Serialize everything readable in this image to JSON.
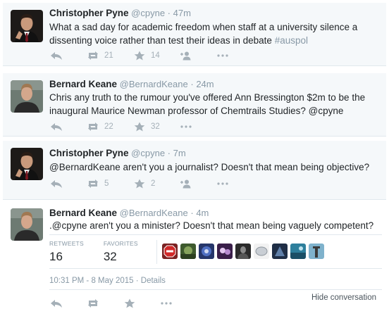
{
  "tweets": [
    {
      "name": "Christopher Pyne",
      "handle": "@cpyne",
      "sep": "·",
      "time": "47m",
      "text": "What a sad day for academic freedom when staff at a university silence a dissenting voice rather than test their ideas in debate ",
      "hashtag": "#auspol",
      "retweets": "21",
      "favorites": "14"
    },
    {
      "name": "Bernard Keane",
      "handle": "@BernardKeane",
      "sep": "·",
      "time": "24m",
      "text": "Chris any truth to the rumour you've offered Ann Bressington $2m to be the inaugural Maurice Newman professor of Chemtrails Studies? @cpyne",
      "retweets": "22",
      "favorites": "32"
    },
    {
      "name": "Christopher Pyne",
      "handle": "@cpyne",
      "sep": "·",
      "time": "7m",
      "text": "@BernardKeane aren't you a journalist? Doesn't that mean being objective?",
      "retweets": "5",
      "favorites": "2"
    },
    {
      "name": "Bernard Keane",
      "handle": "@BernardKeane",
      "sep": "·",
      "time": "4m",
      "text": ".@cpyne aren't you a minister? Doesn't that mean being vaguely competent?",
      "stats": {
        "retweets_label": "RETWEETS",
        "retweets_value": "16",
        "favorites_label": "FAVORITES",
        "favorites_value": "32"
      },
      "datetime": "10:31 PM - 8 May 2015",
      "sep2": " · ",
      "details": "Details",
      "hide_conversation": "Hide conversation"
    }
  ],
  "icons": {
    "reply": "reply-icon",
    "retweet": "retweet-icon",
    "favorite": "star-icon",
    "follow": "add-user-icon",
    "more": "more-dots-icon"
  },
  "colors": {
    "background": "#f5f8fa",
    "text": "#1f2326",
    "muted": "#8899a6",
    "icon": "#a5b0b8"
  }
}
